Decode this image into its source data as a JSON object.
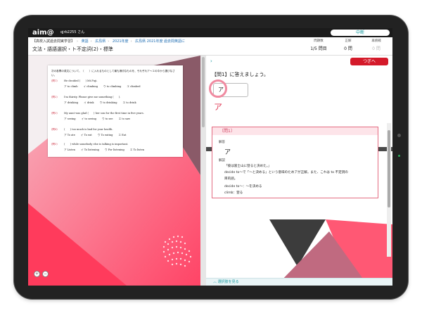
{
  "header": {
    "logo": "aim@",
    "user": "qjrb2255 さん",
    "stop_label": "中断"
  },
  "breadcrumb": {
    "items": [
      "【高校入試過去問実学習】",
      "英語",
      "広島県",
      "2021年度",
      "広島県 2021年度 過去問英語に"
    ]
  },
  "subtitle": "文法・語語選択・ト不定詞(2)・標準",
  "stats": [
    {
      "label": "問題数",
      "value": "1/5 問目"
    },
    {
      "label": "正解",
      "value": "0 問"
    },
    {
      "label": "再挑戦",
      "value": "0 問"
    }
  ],
  "question_card": {
    "instruction": "次の各問の英文について、（　　）に入れるものとして最も適切なものを、それぞれア〜エの中から選びなさい。",
    "items": [
      {
        "num": "(問1)",
        "text": "He decided (　　) Mt.Fuji.",
        "options": [
          "ア to climb",
          "イ climbing",
          "ウ to climbing",
          "エ climbed"
        ]
      },
      {
        "num": "(問2)",
        "text": "I'm thirsty. Please give me something (　　).",
        "options": [
          "ア drinking",
          "イ drink",
          "ウ to drinking",
          "エ to drink"
        ]
      },
      {
        "num": "(問3)",
        "text": "My aunt was glad (　　) her son for the first time in five years.",
        "options": [
          "ア seeing",
          "イ to seeing",
          "ウ to see",
          "エ to saw"
        ]
      },
      {
        "num": "(問4)",
        "text": "(　　) too much is bad for your health.",
        "options": [
          "ア To ate",
          "イ To eat",
          "ウ To eating",
          "エ Eat"
        ]
      },
      {
        "num": "(問5)",
        "text": "(　　) while somebody else is talking is important.",
        "options": [
          "ア Listen",
          "イ To listening",
          "ウ For listening",
          "エ To listen"
        ]
      }
    ]
  },
  "zoom": {
    "in": "+",
    "out": "−"
  },
  "right": {
    "chevron": "›",
    "next_label": "つぎへ",
    "question_title": "【問1】に答えましょう。",
    "answer_value": "ア",
    "big_answer": "ア"
  },
  "explanation": {
    "header": "〔問1〕",
    "answer_label": "解答",
    "answer_value": "ア",
    "expl_label": "解説",
    "lines": [
      "「彼は富士山に登ると決めた。」",
      "decide to～で「～と決める」という意味のためアが正解。また、これは to 不定詞の",
      "目的語。",
      "decide to～：～を決める",
      "climb：登る"
    ]
  },
  "footer": {
    "label": "選択肢を見る"
  },
  "colors": {
    "accent": "#1a9aa0",
    "next_button": "#d41a2a",
    "answer_pink": "#e0405a"
  }
}
